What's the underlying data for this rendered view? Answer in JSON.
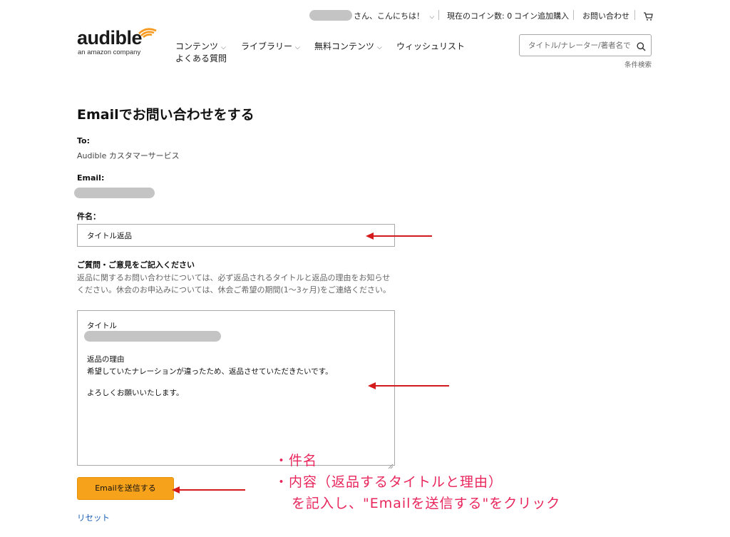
{
  "header": {
    "greeting": "さん、こんにちは！",
    "coins_label": "現在のコイン数: 0",
    "add_coins": "コイン追加購入",
    "contact": "お問い合わせ",
    "logo_text": "audible",
    "logo_sub": "an amazon company"
  },
  "nav": {
    "items": [
      {
        "label": "コンテンツ"
      },
      {
        "label": "ライブラリー"
      },
      {
        "label": "無料コンテンツ"
      },
      {
        "label": "ウィッシュリスト"
      },
      {
        "label": "よくある質問"
      }
    ]
  },
  "search": {
    "placeholder": "タイトル/ナレーター/著者名で",
    "advanced": "条件検索"
  },
  "form": {
    "title": "Emailでお問い合わせをする",
    "to_label": "To:",
    "to_value": "Audible カスタマーサービス",
    "email_label": "Email:",
    "subject_label": "件名：",
    "subject_value": "タイトル返品",
    "message_label": "ご質問・ご意見をご記入ください",
    "help_text": "返品に関するお問い合わせについては、必ず返品されるタイトルと返品の理由をお知らせください。休会のお申込みについては、休会ご希望の期間(1〜3ヶ月)をご連絡ください。",
    "body": {
      "line_title": "タイトル",
      "line_reason_label": "返品の理由",
      "line_reason": "希望していたナレーションが違ったため、返品させていただきたいです。",
      "line_closing": "よろしくお願いいたします。"
    },
    "submit": "Emailを送信する",
    "reset": "リセット"
  },
  "annotation": {
    "line1": "・件名",
    "line2": "・内容（返品するタイトルと理由）",
    "line3": "を記入し、\"Emailを送信する\"をクリック",
    "color": "#e8265c"
  },
  "icons": [
    "chevron-down-icon",
    "cart-icon",
    "search-icon",
    "audible-wifi-logo-icon",
    "resize-grip-icon"
  ]
}
